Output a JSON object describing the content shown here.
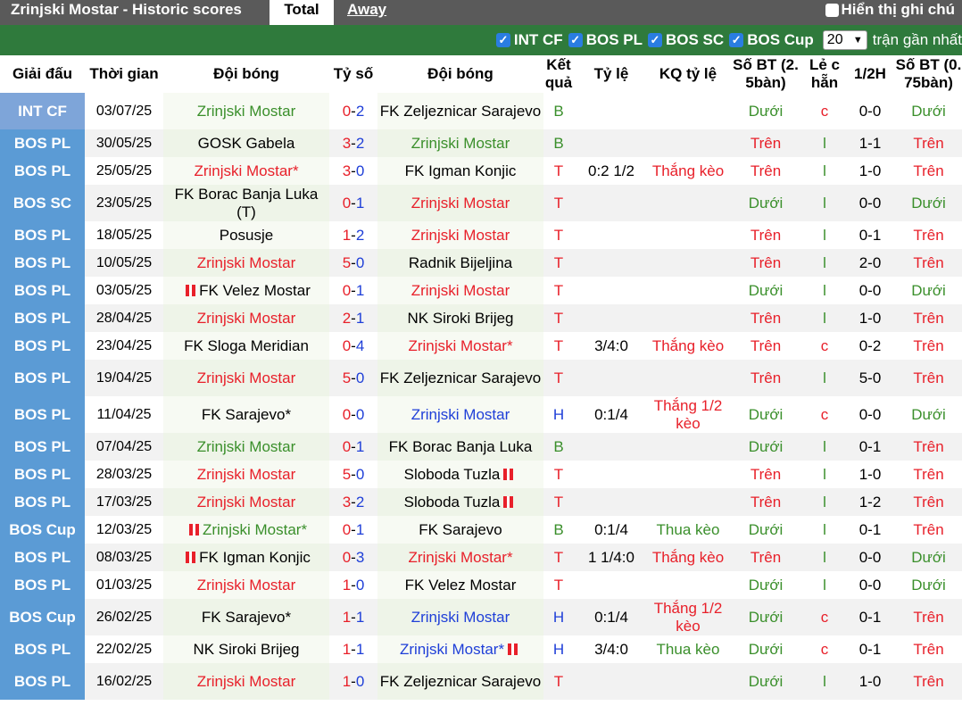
{
  "header": {
    "title": "Zrinjski Mostar - Historic scores",
    "tab_total": "Total",
    "tab_away": "Away",
    "show_label": "Hiển thị ghi chú"
  },
  "filters": {
    "items": [
      "INT CF",
      "BOS PL",
      "BOS SC",
      "BOS Cup"
    ],
    "count_value": "20",
    "recent_label": "trận gần nhất"
  },
  "columns": {
    "league": "Giải đấu",
    "time": "Thời gian",
    "home": "Đội bóng",
    "score": "Tỷ số",
    "away": "Đội bóng",
    "result": "Kết quả",
    "odds": "Tỷ lệ",
    "odds_result": "KQ tỷ lệ",
    "goals25": "Số BT (2. 5bàn)",
    "oddeven": "Lẻ c hẵn",
    "half": "1/2H",
    "goals075": "Số BT (0. 75bàn)"
  },
  "colors": {
    "red": "#e8202a",
    "green": "#3a8f2b",
    "blue": "#1f3fd8",
    "league_bg": "#5b9bd5",
    "filter_bar": "#2f7a3c"
  },
  "rows": [
    {
      "league": "INT CF",
      "date": "03/07/25",
      "home": "Zrinjski Mostar",
      "home_c": "green",
      "home_flag": false,
      "score": "0-2",
      "score_a": "0",
      "score_b": "2",
      "away": "FK Zeljeznicar Sarajevo",
      "away_c": "black",
      "away_flag": false,
      "res": "B",
      "res_c": "green",
      "odds": "",
      "odds_res": "",
      "odds_res_c": "black",
      "g25": "Dưới",
      "g25_c": "green",
      "oe": "c",
      "oe_c": "red",
      "half": "0-0",
      "g075": "Dưới",
      "g075_c": "green"
    },
    {
      "league": "BOS PL",
      "date": "30/05/25",
      "home": "GOSK Gabela",
      "home_c": "black",
      "home_flag": false,
      "score": "3-2",
      "score_a": "3",
      "score_b": "2",
      "away": "Zrinjski Mostar",
      "away_c": "green",
      "away_flag": false,
      "res": "B",
      "res_c": "green",
      "odds": "",
      "odds_res": "",
      "odds_res_c": "black",
      "g25": "Trên",
      "g25_c": "red",
      "oe": "l",
      "oe_c": "green",
      "half": "1-1",
      "g075": "Trên",
      "g075_c": "red"
    },
    {
      "league": "BOS PL",
      "date": "25/05/25",
      "home": "Zrinjski Mostar*",
      "home_c": "red",
      "home_flag": false,
      "score": "3-0",
      "score_a": "3",
      "score_b": "0",
      "away": "FK Igman Konjic",
      "away_c": "black",
      "away_flag": false,
      "res": "T",
      "res_c": "red",
      "odds": "0:2 1/2",
      "odds_res": "Thắng kèo",
      "odds_res_c": "red",
      "g25": "Trên",
      "g25_c": "red",
      "oe": "l",
      "oe_c": "green",
      "half": "1-0",
      "g075": "Trên",
      "g075_c": "red"
    },
    {
      "league": "BOS SC",
      "date": "23/05/25",
      "home": "FK Borac Banja Luka (T)",
      "home_c": "black",
      "home_flag": false,
      "score": "0-1",
      "score_a": "0",
      "score_b": "1",
      "away": "Zrinjski Mostar",
      "away_c": "red",
      "away_flag": false,
      "res": "T",
      "res_c": "red",
      "odds": "",
      "odds_res": "",
      "odds_res_c": "black",
      "g25": "Dưới",
      "g25_c": "green",
      "oe": "l",
      "oe_c": "green",
      "half": "0-0",
      "g075": "Dưới",
      "g075_c": "green"
    },
    {
      "league": "BOS PL",
      "date": "18/05/25",
      "home": "Posusje",
      "home_c": "black",
      "home_flag": false,
      "score": "1-2",
      "score_a": "1",
      "score_b": "2",
      "away": "Zrinjski Mostar",
      "away_c": "red",
      "away_flag": false,
      "res": "T",
      "res_c": "red",
      "odds": "",
      "odds_res": "",
      "odds_res_c": "black",
      "g25": "Trên",
      "g25_c": "red",
      "oe": "l",
      "oe_c": "green",
      "half": "0-1",
      "g075": "Trên",
      "g075_c": "red"
    },
    {
      "league": "BOS PL",
      "date": "10/05/25",
      "home": "Zrinjski Mostar",
      "home_c": "red",
      "home_flag": false,
      "score": "5-0",
      "score_a": "5",
      "score_b": "0",
      "away": "Radnik Bijeljina",
      "away_c": "black",
      "away_flag": false,
      "res": "T",
      "res_c": "red",
      "odds": "",
      "odds_res": "",
      "odds_res_c": "black",
      "g25": "Trên",
      "g25_c": "red",
      "oe": "l",
      "oe_c": "green",
      "half": "2-0",
      "g075": "Trên",
      "g075_c": "red"
    },
    {
      "league": "BOS PL",
      "date": "03/05/25",
      "home": "FK Velez Mostar",
      "home_c": "black",
      "home_flag": true,
      "score": "0-1",
      "score_a": "0",
      "score_b": "1",
      "away": "Zrinjski Mostar",
      "away_c": "red",
      "away_flag": false,
      "res": "T",
      "res_c": "red",
      "odds": "",
      "odds_res": "",
      "odds_res_c": "black",
      "g25": "Dưới",
      "g25_c": "green",
      "oe": "l",
      "oe_c": "green",
      "half": "0-0",
      "g075": "Dưới",
      "g075_c": "green"
    },
    {
      "league": "BOS PL",
      "date": "28/04/25",
      "home": "Zrinjski Mostar",
      "home_c": "red",
      "home_flag": false,
      "score": "2-1",
      "score_a": "2",
      "score_b": "1",
      "away": "NK Siroki Brijeg",
      "away_c": "black",
      "away_flag": false,
      "res": "T",
      "res_c": "red",
      "odds": "",
      "odds_res": "",
      "odds_res_c": "black",
      "g25": "Trên",
      "g25_c": "red",
      "oe": "l",
      "oe_c": "green",
      "half": "1-0",
      "g075": "Trên",
      "g075_c": "red"
    },
    {
      "league": "BOS PL",
      "date": "23/04/25",
      "home": "FK Sloga Meridian",
      "home_c": "black",
      "home_flag": false,
      "score": "0-4",
      "score_a": "0",
      "score_b": "4",
      "away": "Zrinjski Mostar*",
      "away_c": "red",
      "away_flag": false,
      "res": "T",
      "res_c": "red",
      "odds": "3/4:0",
      "odds_res": "Thắng kèo",
      "odds_res_c": "red",
      "g25": "Trên",
      "g25_c": "red",
      "oe": "c",
      "oe_c": "red",
      "half": "0-2",
      "g075": "Trên",
      "g075_c": "red"
    },
    {
      "league": "BOS PL",
      "date": "19/04/25",
      "home": "Zrinjski Mostar",
      "home_c": "red",
      "home_flag": false,
      "score": "5-0",
      "score_a": "5",
      "score_b": "0",
      "away": "FK Zeljeznicar Sarajevo",
      "away_c": "black",
      "away_flag": false,
      "res": "T",
      "res_c": "red",
      "odds": "",
      "odds_res": "",
      "odds_res_c": "black",
      "g25": "Trên",
      "g25_c": "red",
      "oe": "l",
      "oe_c": "green",
      "half": "5-0",
      "g075": "Trên",
      "g075_c": "red"
    },
    {
      "league": "BOS PL",
      "date": "11/04/25",
      "home": "FK Sarajevo*",
      "home_c": "black",
      "home_flag": false,
      "score": "0-0",
      "score_a": "0",
      "score_b": "0",
      "away": "Zrinjski Mostar",
      "away_c": "blue",
      "away_flag": false,
      "res": "H",
      "res_c": "blue",
      "odds": "0:1/4",
      "odds_res": "Thắng 1/2 kèo",
      "odds_res_c": "red",
      "g25": "Dưới",
      "g25_c": "green",
      "oe": "c",
      "oe_c": "red",
      "half": "0-0",
      "g075": "Dưới",
      "g075_c": "green"
    },
    {
      "league": "BOS PL",
      "date": "07/04/25",
      "home": "Zrinjski Mostar",
      "home_c": "green",
      "home_flag": false,
      "score": "0-1",
      "score_a": "0",
      "score_b": "1",
      "away": "FK Borac Banja Luka",
      "away_c": "black",
      "away_flag": false,
      "res": "B",
      "res_c": "green",
      "odds": "",
      "odds_res": "",
      "odds_res_c": "black",
      "g25": "Dưới",
      "g25_c": "green",
      "oe": "l",
      "oe_c": "green",
      "half": "0-1",
      "g075": "Trên",
      "g075_c": "red"
    },
    {
      "league": "BOS PL",
      "date": "28/03/25",
      "home": "Zrinjski Mostar",
      "home_c": "red",
      "home_flag": false,
      "score": "5-0",
      "score_a": "5",
      "score_b": "0",
      "away": "Sloboda Tuzla",
      "away_c": "black",
      "away_flag": true,
      "res": "T",
      "res_c": "red",
      "odds": "",
      "odds_res": "",
      "odds_res_c": "black",
      "g25": "Trên",
      "g25_c": "red",
      "oe": "l",
      "oe_c": "green",
      "half": "1-0",
      "g075": "Trên",
      "g075_c": "red"
    },
    {
      "league": "BOS PL",
      "date": "17/03/25",
      "home": "Zrinjski Mostar",
      "home_c": "red",
      "home_flag": false,
      "score": "3-2",
      "score_a": "3",
      "score_b": "2",
      "away": "Sloboda Tuzla",
      "away_c": "black",
      "away_flag": true,
      "res": "T",
      "res_c": "red",
      "odds": "",
      "odds_res": "",
      "odds_res_c": "black",
      "g25": "Trên",
      "g25_c": "red",
      "oe": "l",
      "oe_c": "green",
      "half": "1-2",
      "g075": "Trên",
      "g075_c": "red"
    },
    {
      "league": "BOS Cup",
      "date": "12/03/25",
      "home": "Zrinjski Mostar*",
      "home_c": "green",
      "home_flag": true,
      "score": "0-1",
      "score_a": "0",
      "score_b": "1",
      "away": "FK Sarajevo",
      "away_c": "black",
      "away_flag": false,
      "res": "B",
      "res_c": "green",
      "odds": "0:1/4",
      "odds_res": "Thua kèo",
      "odds_res_c": "green",
      "g25": "Dưới",
      "g25_c": "green",
      "oe": "l",
      "oe_c": "green",
      "half": "0-1",
      "g075": "Trên",
      "g075_c": "red"
    },
    {
      "league": "BOS PL",
      "date": "08/03/25",
      "home": "FK Igman Konjic",
      "home_c": "black",
      "home_flag": true,
      "score": "0-3",
      "score_a": "0",
      "score_b": "3",
      "away": "Zrinjski Mostar*",
      "away_c": "red",
      "away_flag": false,
      "res": "T",
      "res_c": "red",
      "odds": "1 1/4:0",
      "odds_res": "Thắng kèo",
      "odds_res_c": "red",
      "g25": "Trên",
      "g25_c": "red",
      "oe": "l",
      "oe_c": "green",
      "half": "0-0",
      "g075": "Dưới",
      "g075_c": "green"
    },
    {
      "league": "BOS PL",
      "date": "01/03/25",
      "home": "Zrinjski Mostar",
      "home_c": "red",
      "home_flag": false,
      "score": "1-0",
      "score_a": "1",
      "score_b": "0",
      "away": "FK Velez Mostar",
      "away_c": "black",
      "away_flag": false,
      "res": "T",
      "res_c": "red",
      "odds": "",
      "odds_res": "",
      "odds_res_c": "black",
      "g25": "Dưới",
      "g25_c": "green",
      "oe": "l",
      "oe_c": "green",
      "half": "0-0",
      "g075": "Dưới",
      "g075_c": "green"
    },
    {
      "league": "BOS Cup",
      "date": "26/02/25",
      "home": "FK Sarajevo*",
      "home_c": "black",
      "home_flag": false,
      "score": "1-1",
      "score_a": "1",
      "score_b": "1",
      "away": "Zrinjski Mostar",
      "away_c": "blue",
      "away_flag": false,
      "res": "H",
      "res_c": "blue",
      "odds": "0:1/4",
      "odds_res": "Thắng 1/2 kèo",
      "odds_res_c": "red",
      "g25": "Dưới",
      "g25_c": "green",
      "oe": "c",
      "oe_c": "red",
      "half": "0-1",
      "g075": "Trên",
      "g075_c": "red"
    },
    {
      "league": "BOS PL",
      "date": "22/02/25",
      "home": "NK Siroki Brijeg",
      "home_c": "black",
      "home_flag": false,
      "score": "1-1",
      "score_a": "1",
      "score_b": "1",
      "away": "Zrinjski Mostar*",
      "away_c": "blue",
      "away_flag": true,
      "res": "H",
      "res_c": "blue",
      "odds": "3/4:0",
      "odds_res": "Thua kèo",
      "odds_res_c": "green",
      "g25": "Dưới",
      "g25_c": "green",
      "oe": "c",
      "oe_c": "red",
      "half": "0-1",
      "g075": "Trên",
      "g075_c": "red"
    },
    {
      "league": "BOS PL",
      "date": "16/02/25",
      "home": "Zrinjski Mostar",
      "home_c": "red",
      "home_flag": false,
      "score": "1-0",
      "score_a": "1",
      "score_b": "0",
      "away": "FK Zeljeznicar Sarajevo",
      "away_c": "black",
      "away_flag": false,
      "res": "T",
      "res_c": "red",
      "odds": "",
      "odds_res": "",
      "odds_res_c": "black",
      "g25": "Dưới",
      "g25_c": "green",
      "oe": "l",
      "oe_c": "green",
      "half": "1-0",
      "g075": "Trên",
      "g075_c": "red"
    }
  ]
}
